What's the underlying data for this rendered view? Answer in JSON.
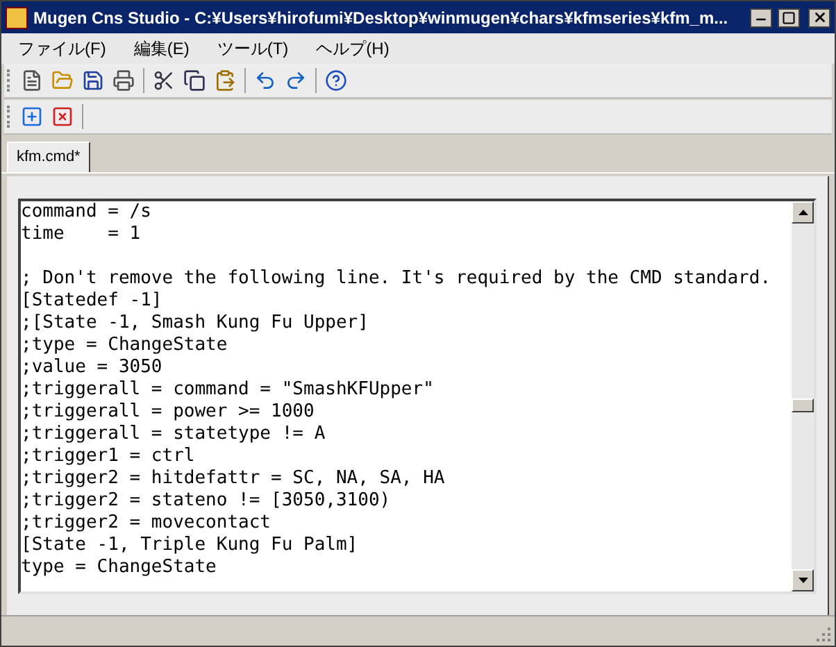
{
  "window": {
    "title": "Mugen Cns Studio - C:¥Users¥hirofumi¥Desktop¥winmugen¥chars¥kfmseries¥kfm_m..."
  },
  "menu": [
    "ファイル(F)",
    "編集(E)",
    "ツール(T)",
    "ヘルプ(H)"
  ],
  "tabs": [
    {
      "label": "kfm.cmd*",
      "selected": true
    }
  ],
  "editor": {
    "blocks": [
      [
        "command = /s",
        "time    = 1"
      ],
      [
        "; Don't remove the following line. It's required by the CMD standard.",
        "[Statedef -1]",
        ";[State -1, Smash Kung Fu Upper]",
        ";type = ChangeState",
        ";value = 3050",
        ";triggerall = command = \"SmashKFUpper\"",
        ";triggerall = power >= 1000",
        ";triggerall = statetype != A",
        ";trigger1 = ctrl",
        ";trigger2 = hitdefattr = SC, NA, SA, HA",
        ";trigger2 = stateno != [3050,3100)",
        ";trigger2 = movecontact",
        "[State -1, Triple Kung Fu Palm]",
        "type = ChangeState"
      ]
    ]
  }
}
